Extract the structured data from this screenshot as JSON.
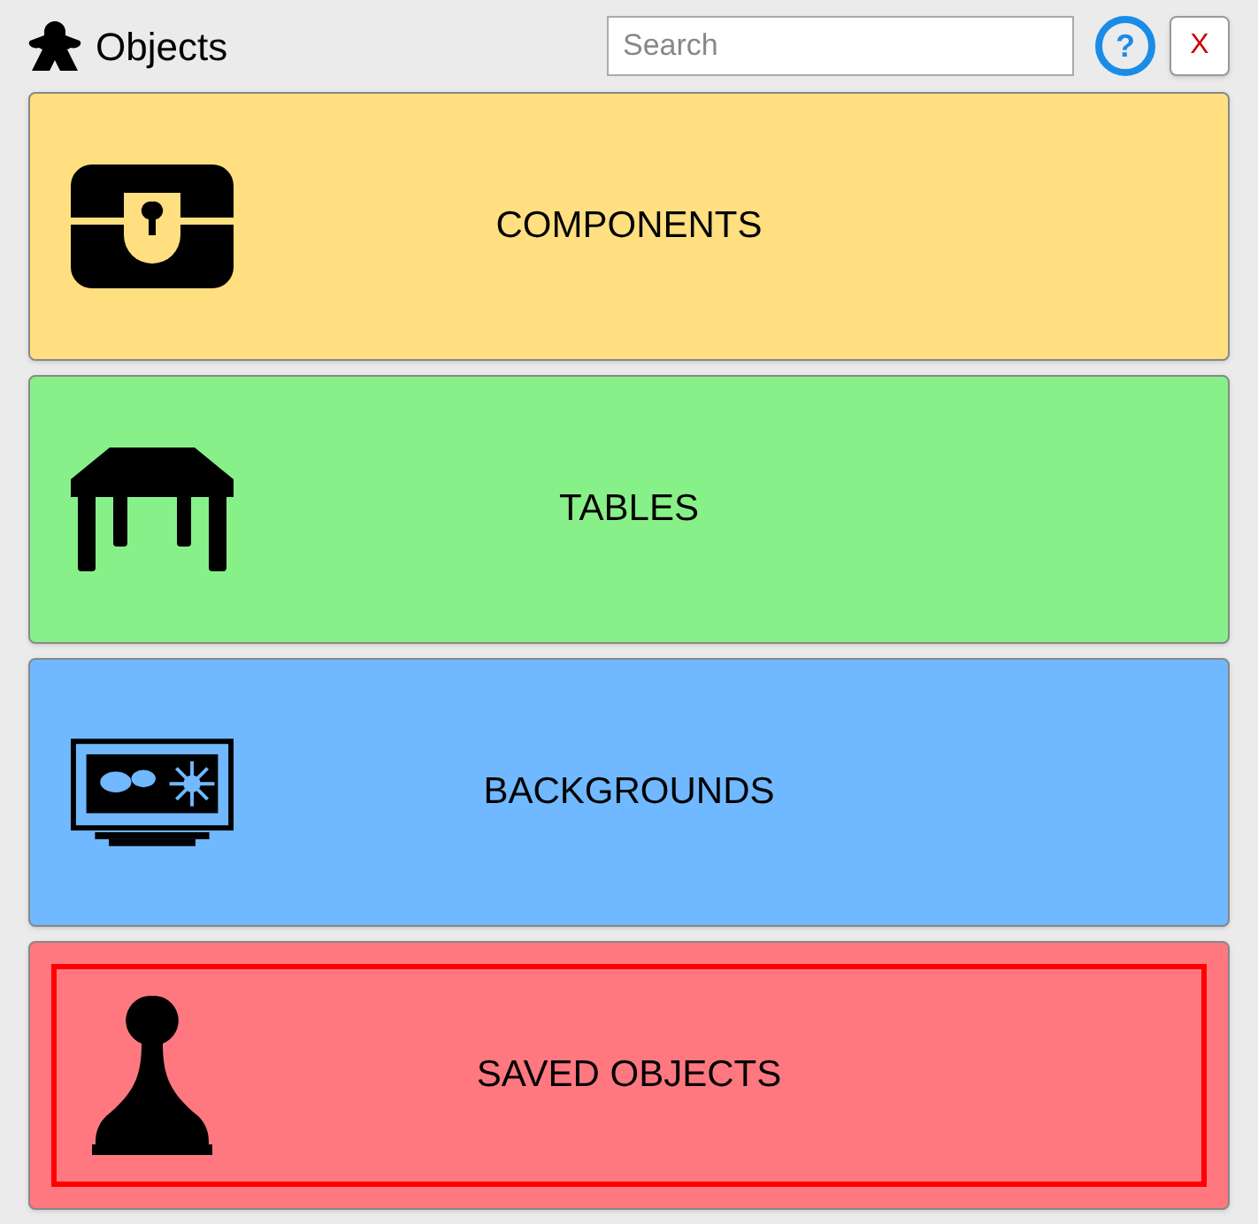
{
  "window": {
    "title": "Objects"
  },
  "search": {
    "placeholder": "Search"
  },
  "help_button": {
    "label": "?"
  },
  "close_button": {
    "label": "X"
  },
  "categories": [
    {
      "label": "COMPONENTS",
      "color": "#ffdf80",
      "selected": false
    },
    {
      "label": "TABLES",
      "color": "#88f088",
      "selected": false
    },
    {
      "label": "BACKGROUNDS",
      "color": "#70b8ff",
      "selected": false
    },
    {
      "label": "SAVED OBJECTS",
      "color": "#ff7880",
      "selected": true
    }
  ]
}
